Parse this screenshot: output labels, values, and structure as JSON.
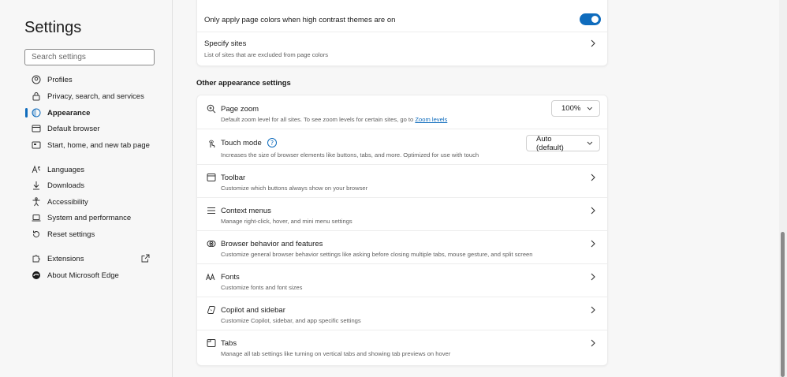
{
  "sidebar": {
    "title": "Settings",
    "search_placeholder": "Search settings",
    "items": [
      {
        "label": "Profiles",
        "icon": "profile-icon"
      },
      {
        "label": "Privacy, search, and services",
        "icon": "lock-icon"
      },
      {
        "label": "Appearance",
        "icon": "appearance-icon",
        "active": true
      },
      {
        "label": "Default browser",
        "icon": "browser-icon"
      },
      {
        "label": "Start, home, and new tab page",
        "icon": "home-tab-icon"
      },
      {
        "label": "Languages",
        "icon": "languages-icon"
      },
      {
        "label": "Downloads",
        "icon": "download-icon"
      },
      {
        "label": "Accessibility",
        "icon": "accessibility-icon"
      },
      {
        "label": "System and performance",
        "icon": "laptop-icon"
      },
      {
        "label": "Reset settings",
        "icon": "reset-icon"
      },
      {
        "label": "Extensions",
        "icon": "puzzle-icon"
      },
      {
        "label": "About Microsoft Edge",
        "icon": "edge-icon"
      }
    ]
  },
  "page_colors": {
    "only_apply_label": "Only apply page colors when high contrast themes are on",
    "toggle_on": true,
    "specify_sites_title": "Specify sites",
    "specify_sites_desc": "List of sites that are excluded from page colors"
  },
  "other": {
    "heading": "Other appearance settings",
    "page_zoom": {
      "title": "Page zoom",
      "desc": "Default zoom level for all sites. To see zoom levels for certain sites, go to",
      "link": "Zoom levels",
      "value": "100%"
    },
    "touch_mode": {
      "title": "Touch mode",
      "help": "?",
      "desc": "Increases the size of browser elements like buttons, tabs, and more. Optimized for use with touch",
      "value": "Auto (default)"
    },
    "rows": [
      {
        "title": "Toolbar",
        "desc": "Customize which buttons always show on your browser",
        "icon": "toolbar-icon"
      },
      {
        "title": "Context menus",
        "desc": "Manage right-click, hover, and mini menu settings",
        "icon": "menu-icon"
      },
      {
        "title": "Browser behavior and features",
        "desc": "Customize general browser behavior settings like asking before closing multiple tabs, mouse gesture, and split screen",
        "icon": "behavior-icon"
      },
      {
        "title": "Fonts",
        "desc": "Customize fonts and font sizes",
        "icon": "fonts-icon"
      },
      {
        "title": "Copilot and sidebar",
        "desc": "Customize Copilot, sidebar, and app specific settings",
        "icon": "copilot-icon"
      },
      {
        "title": "Tabs",
        "desc": "Manage all tab settings like turning on vertical tabs and showing tab previews on hover",
        "icon": "tabs-icon"
      }
    ]
  },
  "colors": {
    "accent": "#0f6cbd",
    "background": "#f7f7f7",
    "card": "#ffffff"
  }
}
